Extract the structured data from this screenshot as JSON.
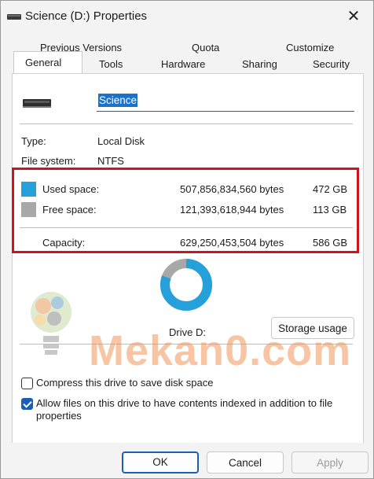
{
  "window": {
    "title": "Science (D:) Properties",
    "close_glyph": "✕"
  },
  "tabs": {
    "row1": [
      "Previous Versions",
      "Quota",
      "Customize"
    ],
    "row2": [
      "General",
      "Tools",
      "Hardware",
      "Sharing",
      "Security"
    ],
    "active": "General"
  },
  "general": {
    "volume_label": "Science",
    "type_label": "Type:",
    "type_value": "Local Disk",
    "fs_label": "File system:",
    "fs_value": "NTFS",
    "used": {
      "label": "Used space:",
      "bytes": "507,856,834,560 bytes",
      "size": "472 GB",
      "color": "#26a0da"
    },
    "free": {
      "label": "Free space:",
      "bytes": "121,393,618,944 bytes",
      "size": "113 GB",
      "color": "#a8a8a8"
    },
    "capacity": {
      "label": "Capacity:",
      "bytes": "629,250,453,504 bytes",
      "size": "586 GB"
    },
    "drive_label": "Drive D:",
    "storage_button": "Storage usage",
    "used_fraction": 0.807,
    "compress_label": "Compress this drive to save disk space",
    "compress_checked": false,
    "index_label_line1": "Allow files on this drive to have contents indexed in addition to file",
    "index_label_line2": "properties",
    "index_checked": true
  },
  "watermark": "Mekan0.com",
  "buttons": {
    "ok": "OK",
    "cancel": "Cancel",
    "apply": "Apply"
  },
  "colors": {
    "highlight_box": "#d0141e",
    "accent": "#1a5fb4"
  }
}
